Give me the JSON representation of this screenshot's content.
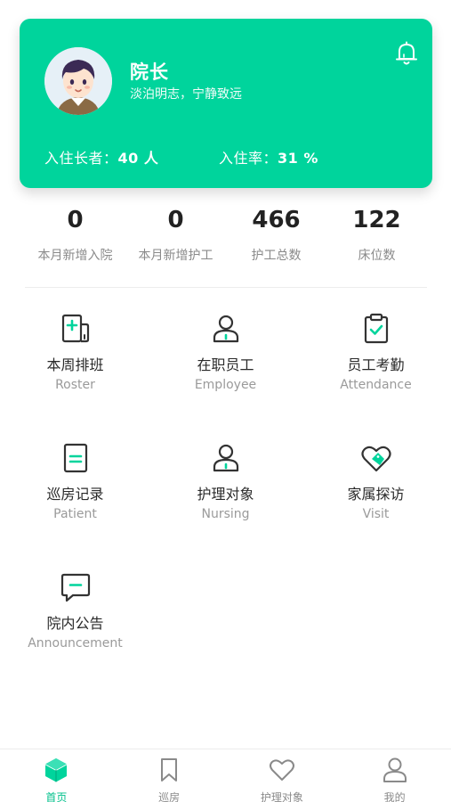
{
  "colors": {
    "accent": "#00d49c",
    "accent_dark": "#00c08b",
    "icon_dark": "#333333"
  },
  "header": {
    "name": "院长",
    "motto": "淡泊明志，宁静致远",
    "residents_label": "入住长者：",
    "residents_value": "40 人",
    "occupancy_label": "入住率：",
    "occupancy_value": "31 %"
  },
  "stats": [
    {
      "value": "0",
      "label": "本月新增入院"
    },
    {
      "value": "0",
      "label": "本月新增护工"
    },
    {
      "value": "466",
      "label": "护工总数"
    },
    {
      "value": "122",
      "label": "床位数"
    }
  ],
  "menu": [
    {
      "title": "本周排班",
      "subtitle": "Roster",
      "icon": "roster-icon"
    },
    {
      "title": "在职员工",
      "subtitle": "Employee",
      "icon": "employee-icon"
    },
    {
      "title": "员工考勤",
      "subtitle": "Attendance",
      "icon": "clipboard-check-icon"
    },
    {
      "title": "巡房记录",
      "subtitle": "Patient",
      "icon": "document-icon"
    },
    {
      "title": "护理对象",
      "subtitle": "Nursing",
      "icon": "person-icon"
    },
    {
      "title": "家属探访",
      "subtitle": "Visit",
      "icon": "heart-tag-icon"
    },
    {
      "title": "院内公告",
      "subtitle": "Announcement",
      "icon": "message-icon"
    }
  ],
  "tabs": [
    {
      "label": "首页",
      "icon": "home-cube-icon",
      "active": true
    },
    {
      "label": "巡房",
      "icon": "bookmark-icon",
      "active": false
    },
    {
      "label": "护理对象",
      "icon": "heart-icon",
      "active": false
    },
    {
      "label": "我的",
      "icon": "user-icon",
      "active": false
    }
  ]
}
